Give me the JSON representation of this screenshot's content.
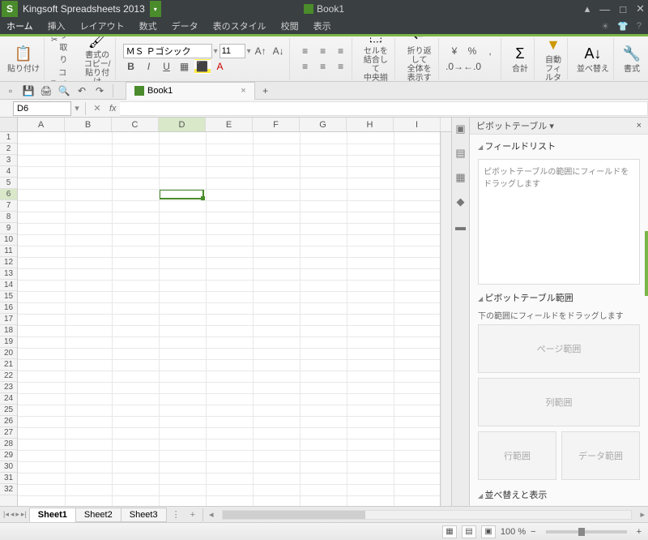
{
  "title": {
    "app": "Kingsoft Spreadsheets 2013",
    "doc": "Book1"
  },
  "menu": {
    "items": [
      "ホーム",
      "挿入",
      "レイアウト",
      "数式",
      "データ",
      "表のスタイル",
      "校閲",
      "表示"
    ],
    "active": 0
  },
  "ribbon": {
    "paste": "貼り付け",
    "cut": "切り取り",
    "copy": "コピー",
    "format_painter": "書式のコピー/\n貼り付け",
    "font": "ＭＳ Ｐゴシック",
    "size": "11",
    "merge": "セルを結合して\n中央揃え",
    "wrap": "折り返して\n全体を表示する",
    "sum": "合計",
    "autofilter": "自動\nフィルタ",
    "sort": "並べ替え",
    "format": "書式"
  },
  "tabs": {
    "doc": "Book1"
  },
  "formula": {
    "namebox": "D6"
  },
  "grid": {
    "cols": [
      "A",
      "B",
      "C",
      "D",
      "E",
      "F",
      "G",
      "H",
      "I"
    ],
    "rows": 32,
    "selected": {
      "col": 3,
      "row": 5
    }
  },
  "sheets": {
    "items": [
      "Sheet1",
      "Sheet2",
      "Sheet3"
    ],
    "active": 0
  },
  "pivot": {
    "title": "ピボットテーブル",
    "field_list": "フィールドリスト",
    "field_hint": "ピボットテーブルの範囲にフィールドをドラッグします",
    "range_title": "ピボットテーブル範囲",
    "range_hint": "下の範囲にフィールドをドラッグします",
    "page_area": "ページ範囲",
    "col_area": "列範囲",
    "row_area": "行範囲",
    "data_area": "データ範囲",
    "sort_display": "並べ替えと表示"
  },
  "status": {
    "zoom": "100 %"
  }
}
